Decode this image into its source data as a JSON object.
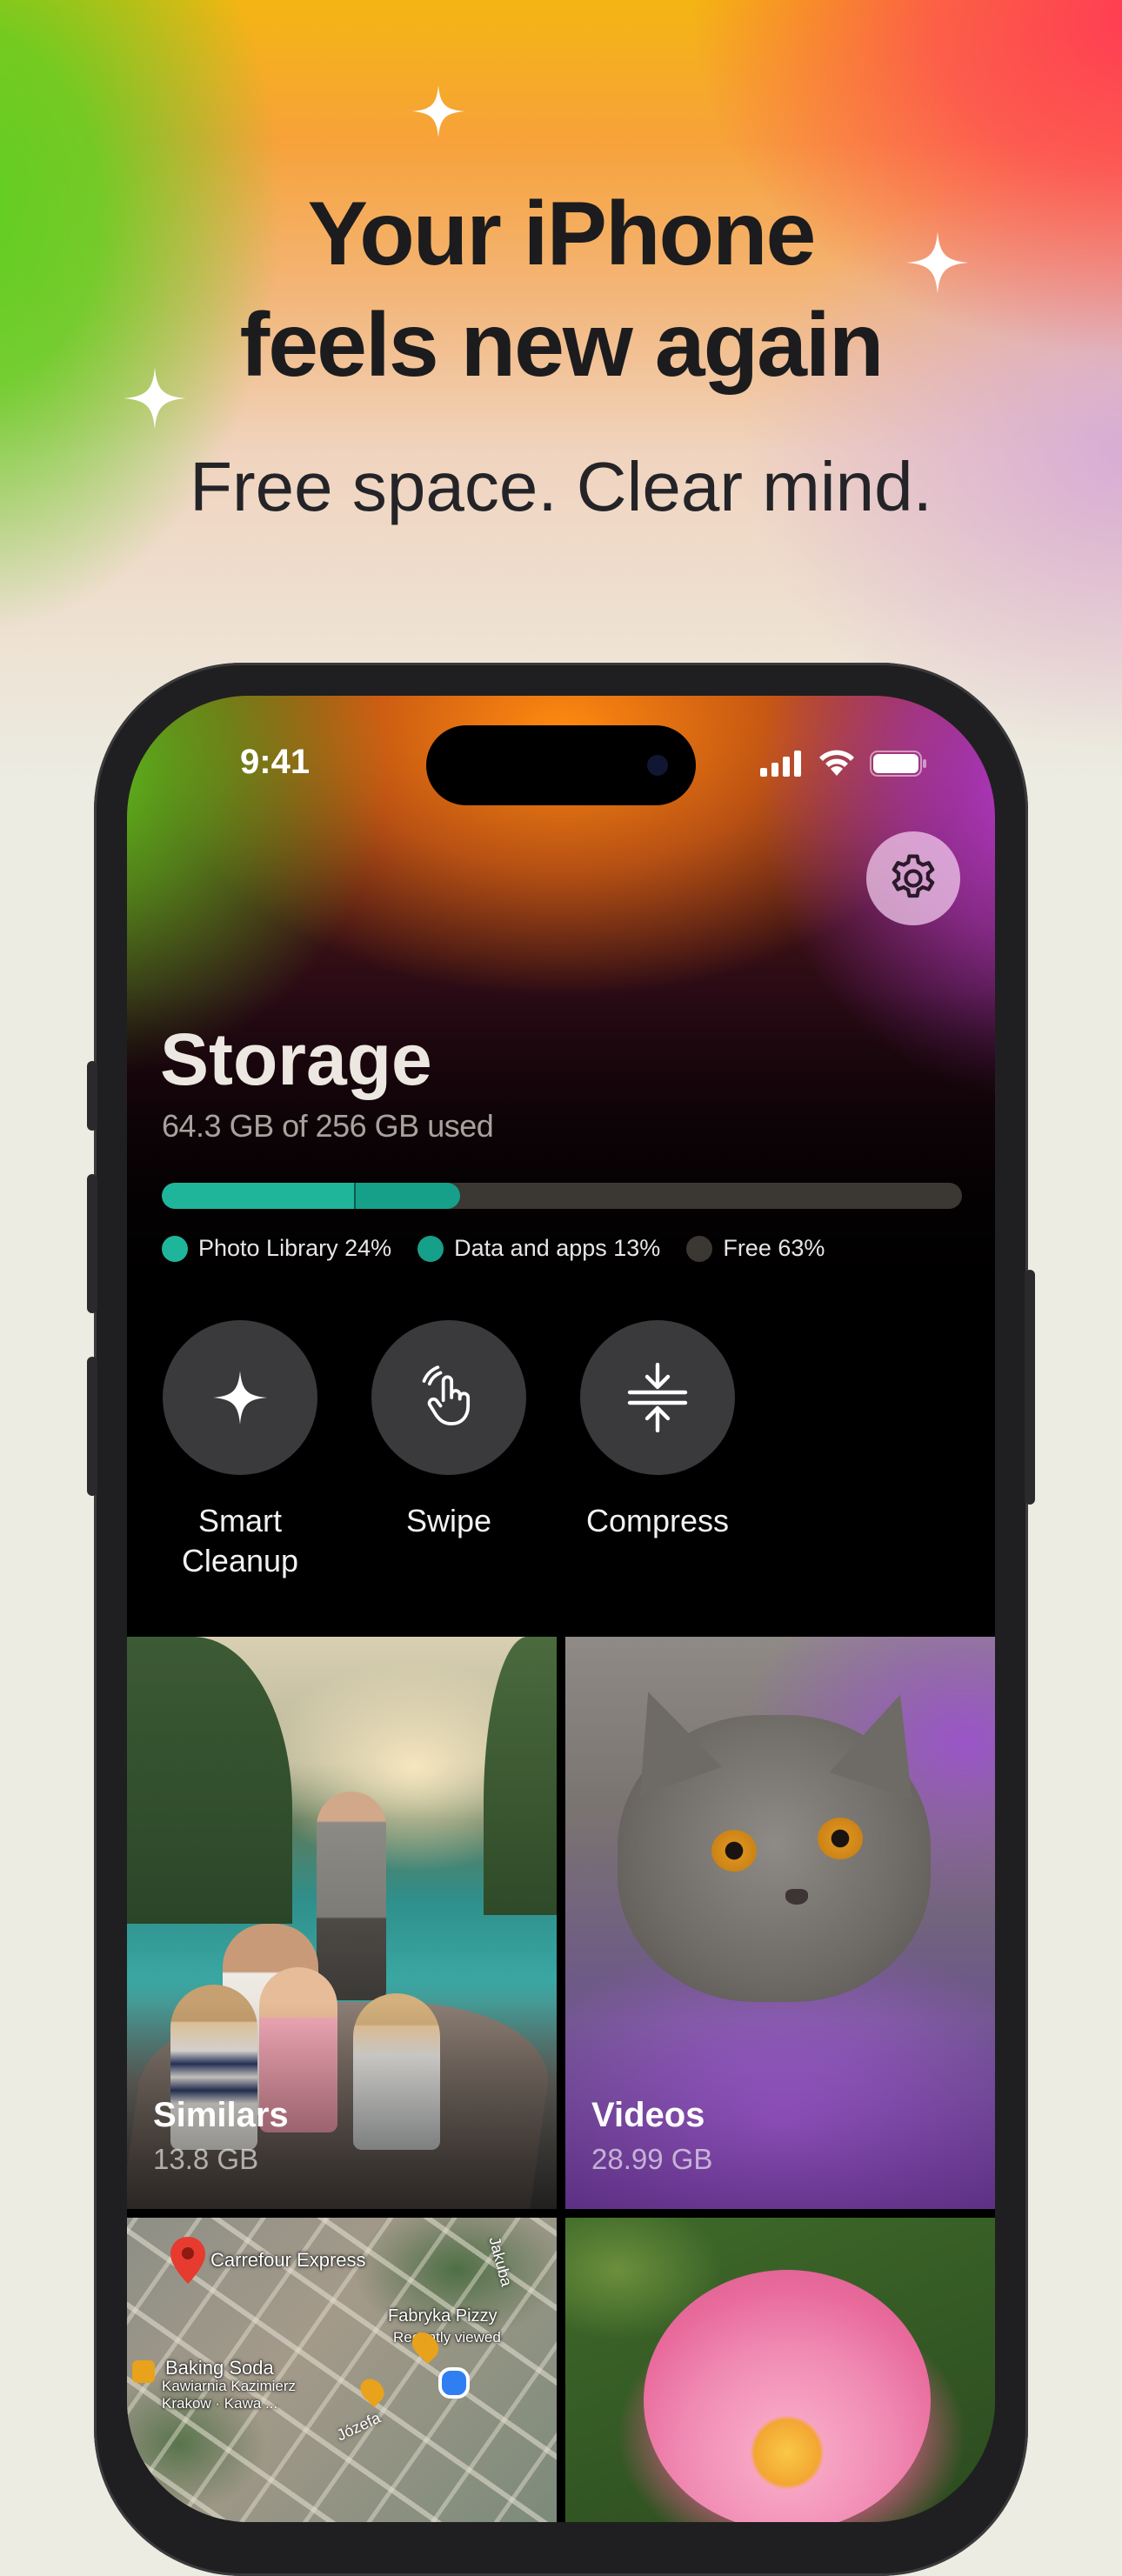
{
  "hero": {
    "title_line1": "Your iPhone",
    "title_line2": "feels new again",
    "subtitle": "Free space. Clear mind."
  },
  "status_bar": {
    "time": "9:41",
    "icons": [
      "cellular-signal-icon",
      "wifi-icon",
      "battery-icon"
    ]
  },
  "settings": {
    "icon": "gear-icon"
  },
  "storage": {
    "title": "Storage",
    "usage_text": "64.3 GB of 256 GB used",
    "used_gb": 64.3,
    "total_gb": 256,
    "segments": [
      {
        "label": "Photo Library 24%",
        "fraction": 0.24,
        "color": "#1fb59a"
      },
      {
        "label": "Data and apps 13%",
        "fraction": 0.13,
        "color": "#16a089"
      },
      {
        "label": "Free 63%",
        "fraction": 0.63,
        "color": "#3b3733"
      }
    ]
  },
  "actions": [
    {
      "label": "Smart Cleanup",
      "icon": "sparkle-icon"
    },
    {
      "label": "Swipe",
      "icon": "hand-swipe-icon"
    },
    {
      "label": "Compress",
      "icon": "compress-icon"
    }
  ],
  "tiles": [
    {
      "label": "Similars",
      "size": "13.8 GB"
    },
    {
      "label": "Videos",
      "size": "28.99 GB"
    }
  ],
  "map_tile": {
    "places": [
      "Carrefour Express",
      "Fabryka Pizzy",
      "Recently viewed",
      "Baking Soda",
      "Kawiarnia Kazimierz",
      "Krakow · Kawa ...",
      "Jakuba",
      "Józefa"
    ]
  },
  "colors": {
    "accent": "#1fb59a",
    "accent_dark": "#16a089",
    "screen_bg": "#000000",
    "page_bg": "#ecece2"
  }
}
